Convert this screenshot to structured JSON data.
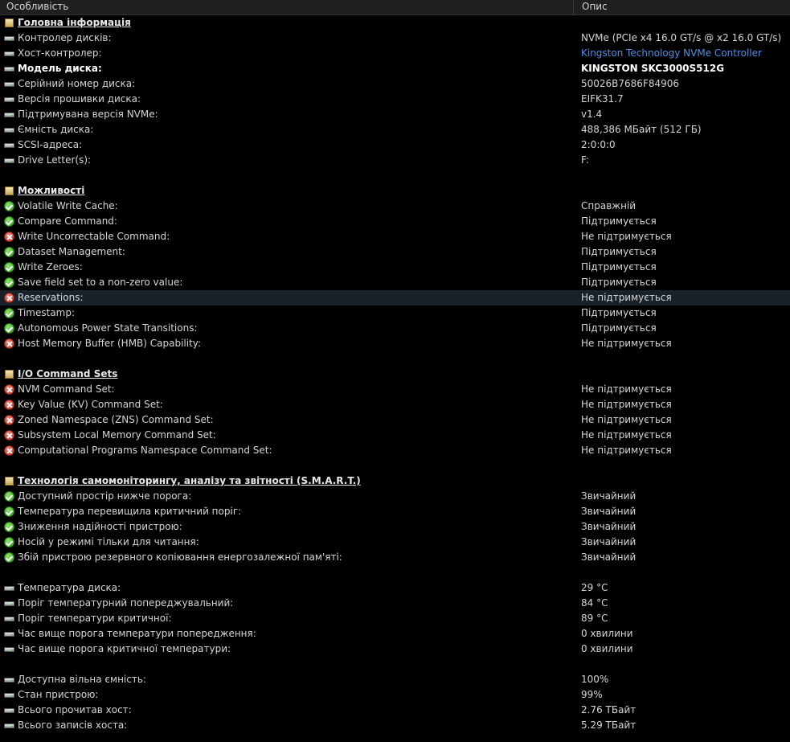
{
  "header": {
    "col_feature": "Особливість",
    "col_description": "Опис"
  },
  "rows": [
    {
      "type": "section",
      "label": "Головна інформація",
      "value": "",
      "icon": "section-icon"
    },
    {
      "type": "item",
      "icon": "drive-icon",
      "label": "Контролер дисків:",
      "value": "NVMe (PCIe x4 16.0 GT/s @ x2 16.0 GT/s)"
    },
    {
      "type": "item",
      "icon": "drive-icon",
      "label": "Хост-контролер:",
      "value": "Kingston Technology NVMe Controller",
      "link": true
    },
    {
      "type": "item",
      "icon": "drive-icon",
      "label": "Модель диска:",
      "value": "KINGSTON SKC3000S512G",
      "bold": true
    },
    {
      "type": "item",
      "icon": "drive-icon",
      "label": "Серійний номер диска:",
      "value": "50026B7686F84906"
    },
    {
      "type": "item",
      "icon": "drive-icon",
      "label": "Версія прошивки диска:",
      "value": "EIFK31.7"
    },
    {
      "type": "item",
      "icon": "drive-icon",
      "label": "Підтримувана версія NVMe:",
      "value": "v1.4"
    },
    {
      "type": "item",
      "icon": "drive-icon",
      "label": "Ємність диска:",
      "value": "488,386 МБайт (512 ГБ)"
    },
    {
      "type": "item",
      "icon": "drive-icon",
      "label": "SCSI-адреса:",
      "value": "2:0:0:0"
    },
    {
      "type": "item",
      "icon": "drive-icon",
      "label": "Drive Letter(s):",
      "value": "F:"
    },
    {
      "type": "blank"
    },
    {
      "type": "section",
      "label": "Можливості",
      "value": "",
      "icon": "section-icon"
    },
    {
      "type": "item",
      "icon": "check-icon",
      "label": "Volatile Write Cache:",
      "value": "Справжній"
    },
    {
      "type": "item",
      "icon": "check-icon",
      "label": "Compare Command:",
      "value": "Підтримується"
    },
    {
      "type": "item",
      "icon": "cross-icon",
      "label": "Write Uncorrectable Command:",
      "value": "Не підтримується"
    },
    {
      "type": "item",
      "icon": "check-icon",
      "label": "Dataset Management:",
      "value": "Підтримується"
    },
    {
      "type": "item",
      "icon": "check-icon",
      "label": "Write Zeroes:",
      "value": "Підтримується"
    },
    {
      "type": "item",
      "icon": "check-icon",
      "label": "Save field set to a non-zero value:",
      "value": "Підтримується"
    },
    {
      "type": "item",
      "icon": "cross-icon",
      "label": "Reservations:",
      "value": "Не підтримується",
      "highlight": true
    },
    {
      "type": "item",
      "icon": "check-icon",
      "label": "Timestamp:",
      "value": "Підтримується"
    },
    {
      "type": "item",
      "icon": "check-icon",
      "label": "Autonomous Power State Transitions:",
      "value": "Підтримується"
    },
    {
      "type": "item",
      "icon": "cross-icon",
      "label": "Host Memory Buffer (HMB) Capability:",
      "value": "Не підтримується"
    },
    {
      "type": "blank"
    },
    {
      "type": "section",
      "label": "I/O Command Sets",
      "value": "",
      "icon": "section-icon"
    },
    {
      "type": "item",
      "icon": "cross-icon",
      "label": "NVM Command Set:",
      "value": "Не підтримується"
    },
    {
      "type": "item",
      "icon": "cross-icon",
      "label": "Key Value (KV) Command Set:",
      "value": "Не підтримується"
    },
    {
      "type": "item",
      "icon": "cross-icon",
      "label": "Zoned Namespace (ZNS) Command Set:",
      "value": "Не підтримується"
    },
    {
      "type": "item",
      "icon": "cross-icon",
      "label": "Subsystem Local Memory Command Set:",
      "value": "Не підтримується"
    },
    {
      "type": "item",
      "icon": "cross-icon",
      "label": "Computational Programs Namespace Command Set:",
      "value": "Не підтримується"
    },
    {
      "type": "blank"
    },
    {
      "type": "section",
      "label": "Технологія самомоніторингу, аналізу та звітності (S.M.A.R.T.)",
      "value": "",
      "icon": "section-icon"
    },
    {
      "type": "item",
      "icon": "check-icon",
      "label": "Доступний простір нижче порога:",
      "value": "Звичайний"
    },
    {
      "type": "item",
      "icon": "check-icon",
      "label": "Температура перевищила критичний поріг:",
      "value": "Звичайний"
    },
    {
      "type": "item",
      "icon": "check-icon",
      "label": "Зниження надійності пристрою:",
      "value": "Звичайний"
    },
    {
      "type": "item",
      "icon": "check-icon",
      "label": "Носій у режимі тільки для читання:",
      "value": "Звичайний"
    },
    {
      "type": "item",
      "icon": "check-icon",
      "label": "Збій пристрою резервного копіювання енергозалежної пам'яті:",
      "value": "Звичайний"
    },
    {
      "type": "blank"
    },
    {
      "type": "item",
      "icon": "drive-icon",
      "label": "Температура диска:",
      "value": "29 °C"
    },
    {
      "type": "item",
      "icon": "drive-icon",
      "label": "Поріг температурний попереджувальний:",
      "value": "84 °C"
    },
    {
      "type": "item",
      "icon": "drive-icon",
      "label": "Поріг температури критичної:",
      "value": "89 °C"
    },
    {
      "type": "item",
      "icon": "drive-icon",
      "label": "Час вище порога температури попередження:",
      "value": "0 хвилини"
    },
    {
      "type": "item",
      "icon": "drive-icon",
      "label": "Час вище порога критичної температури:",
      "value": "0 хвилини"
    },
    {
      "type": "blank"
    },
    {
      "type": "item",
      "icon": "drive-icon",
      "label": "Доступна вільна ємність:",
      "value": "100%"
    },
    {
      "type": "item",
      "icon": "drive-icon",
      "label": "Стан пристрою:",
      "value": "99%"
    },
    {
      "type": "item",
      "icon": "drive-icon",
      "label": "Всього прочитав хост:",
      "value": "2.76 ТБайт"
    },
    {
      "type": "item",
      "icon": "drive-icon",
      "label": "Всього записів хоста:",
      "value": "5.29 ТБайт"
    }
  ]
}
